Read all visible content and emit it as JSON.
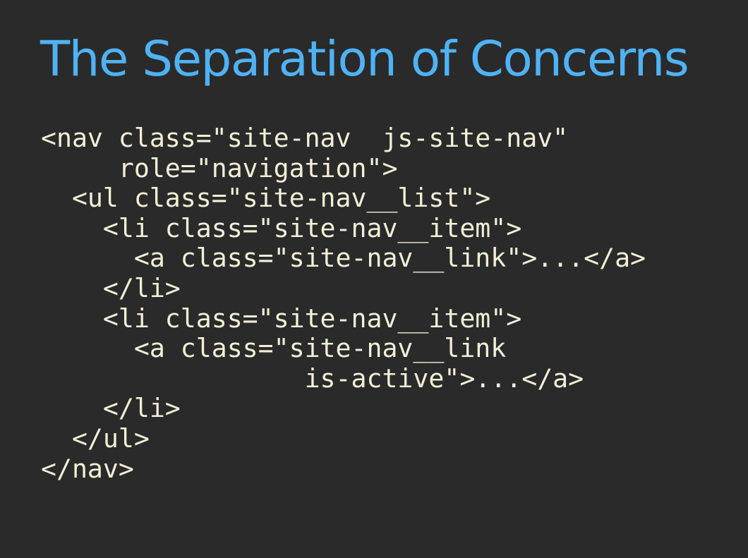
{
  "slide": {
    "title": "The Separation of Concerns",
    "code_lines": [
      "<nav class=\"site-nav  js-site-nav\"",
      "     role=\"navigation\">",
      "  <ul class=\"site-nav__list\">",
      "    <li class=\"site-nav__item\">",
      "      <a class=\"site-nav__link\">...</a>",
      "    </li>",
      "    <li class=\"site-nav__item\">",
      "      <a class=\"site-nav__link",
      "                 is-active\">...</a>",
      "    </li>",
      "  </ul>",
      "</nav>"
    ]
  },
  "colors": {
    "background": "#2a2a2a",
    "title": "#4fb2f5",
    "code_text": "#f3efd6"
  }
}
